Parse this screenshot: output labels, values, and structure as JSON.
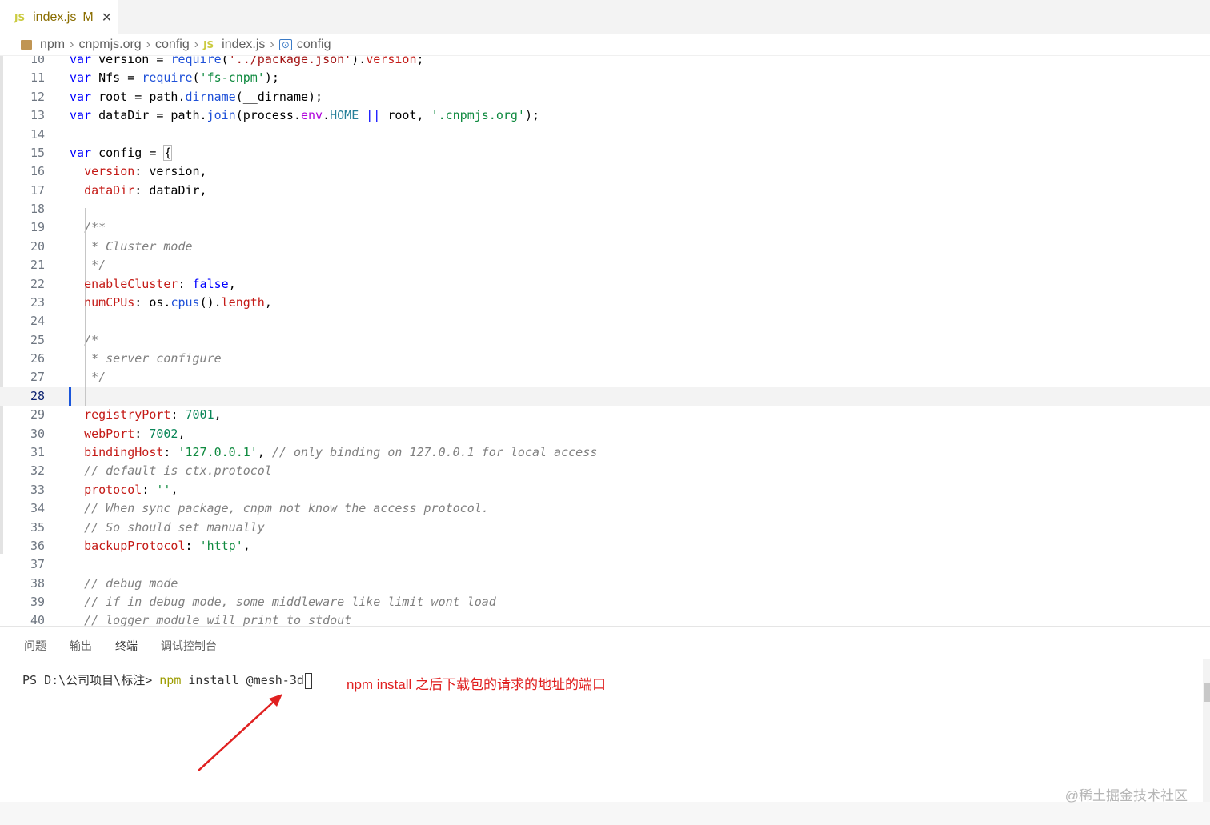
{
  "tab": {
    "badge": "JS",
    "name": "index.js",
    "modified": "M",
    "close": "✕"
  },
  "breadcrumb": {
    "items": [
      "npm",
      "cnpmjs.org",
      "config",
      "index.js",
      "config"
    ],
    "sep": "›",
    "js_badge": "JS"
  },
  "editor": {
    "line_numbers": [
      "10",
      "11",
      "12",
      "13",
      "14",
      "15",
      "16",
      "17",
      "18",
      "19",
      "20",
      "21",
      "22",
      "23",
      "24",
      "25",
      "26",
      "27",
      "28",
      "29",
      "30",
      "31",
      "32",
      "33",
      "34",
      "35",
      "36",
      "37",
      "38",
      "39",
      "40"
    ],
    "current_line": "28"
  },
  "panel": {
    "tabs": [
      "问题",
      "输出",
      "终端",
      "调试控制台"
    ],
    "active_tab": "终端",
    "terminal": {
      "prompt": "PS D:\\公司项目\\标注> ",
      "cmd": "npm",
      "args": " install @mesh-3d"
    },
    "annotation": "npm install 之后下载包的请求的地址的端口"
  },
  "watermark": "@稀土掘金技术社区",
  "colors": {
    "keyword": "#0000ff",
    "property": "#c41a16",
    "comment": "#808080",
    "annotation": "#e02020"
  }
}
